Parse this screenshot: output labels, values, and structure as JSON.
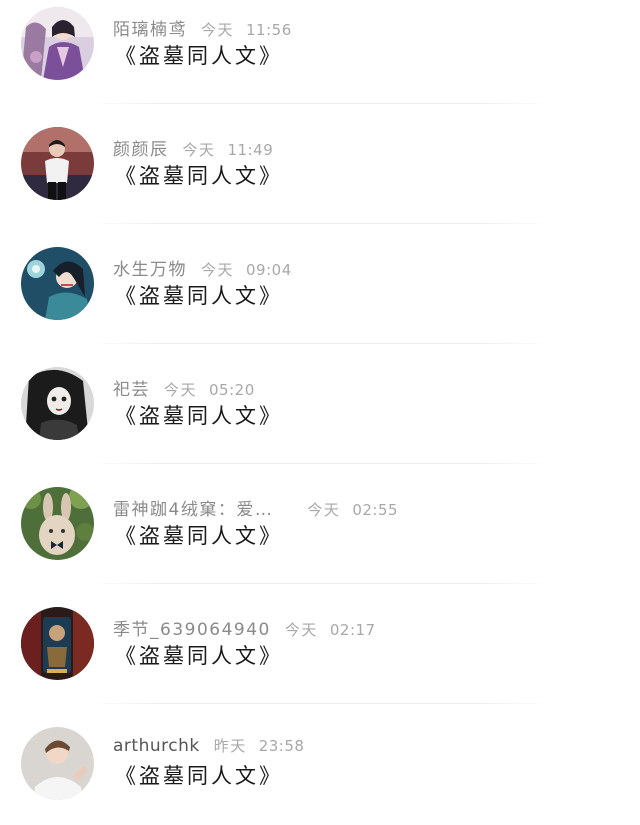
{
  "comments": [
    {
      "name": "陌璃楠鸢",
      "day": "今天",
      "time": "11:56",
      "message": "《盗墓同人文》",
      "avatar": "avatar-ancient-costume-woman"
    },
    {
      "name": "颜颜辰",
      "day": "今天",
      "time": "11:49",
      "message": "《盗墓同人文》",
      "avatar": "avatar-young-man-white-shirt"
    },
    {
      "name": "水生万物",
      "day": "今天",
      "time": "09:04",
      "message": "《盗墓同人文》",
      "avatar": "avatar-illustrated-woman-lotus"
    },
    {
      "name": "祀芸",
      "day": "今天",
      "time": "05:20",
      "message": "《盗墓同人文》",
      "avatar": "avatar-gothic-doll-girl"
    },
    {
      "name": "雷神跏4绒窠：爱…",
      "day": "今天",
      "time": "02:55",
      "message": "《盗墓同人文》",
      "avatar": "avatar-rabbit-bowtie"
    },
    {
      "name": "季节_639064940",
      "day": "今天",
      "time": "02:17",
      "message": "《盗墓同人文》",
      "avatar": "avatar-game-character"
    },
    {
      "name": "arthurchk",
      "day": "昨天",
      "time": "23:58",
      "message": "《盗墓同人文》",
      "avatar": "avatar-young-man-light"
    }
  ]
}
